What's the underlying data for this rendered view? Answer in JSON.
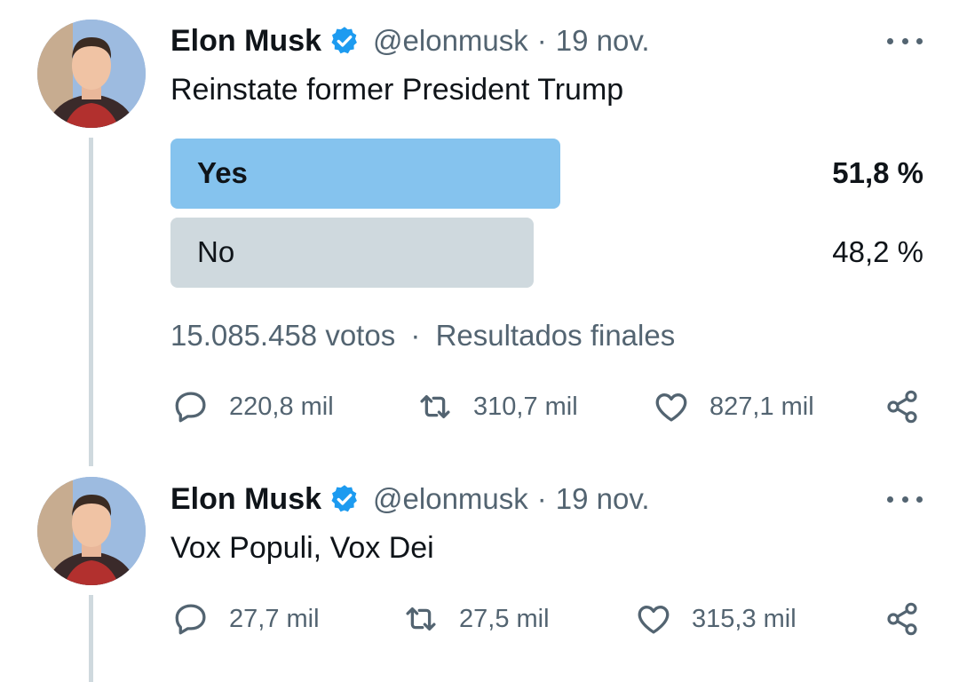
{
  "tweets": [
    {
      "author_name": "Elon Musk",
      "handle": "@elonmusk",
      "separator": "·",
      "date": "19 nov.",
      "text": "Reinstate former President Trump",
      "poll": {
        "options": [
          {
            "label": "Yes",
            "percent_text": "51,8 %",
            "percent": 51.8
          },
          {
            "label": "No",
            "percent_text": "48,2 %",
            "percent": 48.2
          }
        ],
        "votes": "15.085.458 votos",
        "separator": "·",
        "status": "Resultados finales"
      },
      "actions": {
        "replies": "220,8 mil",
        "retweets": "310,7 mil",
        "likes": "827,1 mil"
      }
    },
    {
      "author_name": "Elon Musk",
      "handle": "@elonmusk",
      "separator": "·",
      "date": "19 nov.",
      "text": "Vox Populi, Vox Dei",
      "actions": {
        "replies": "27,7 mil",
        "retweets": "27,5 mil",
        "likes": "315,3 mil"
      }
    }
  ],
  "icons": [
    "verified-icon",
    "more-icon",
    "reply-icon",
    "retweet-icon",
    "like-icon",
    "share-icon"
  ],
  "colors": {
    "accent": "#1d9bf0",
    "poll_winner": "#85c3ee",
    "poll_loser": "#cfd9de",
    "secondary_text": "#536471"
  }
}
